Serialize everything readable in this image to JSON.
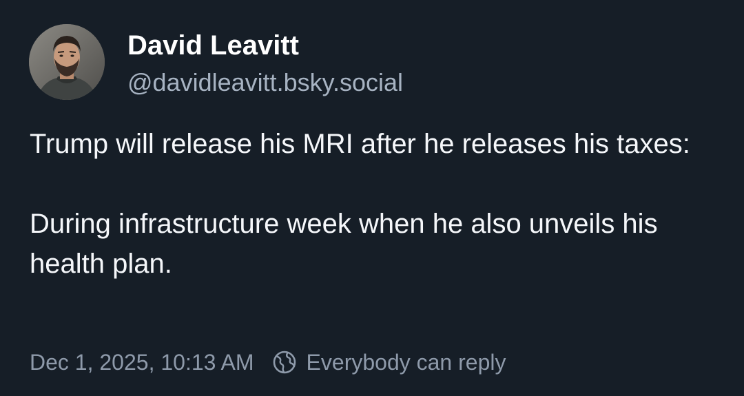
{
  "post": {
    "author": {
      "display_name": "David Leavitt",
      "handle": "@davidleavitt.bsky.social",
      "avatar_icon": "user-avatar-photo"
    },
    "text_paragraphs": [
      "Trump will release his MRI after he releases his taxes:",
      "During infrastructure week when he also unveils his health plan."
    ],
    "timestamp": "Dec 1, 2025, 10:13 AM",
    "reply_setting": {
      "icon": "earth-icon",
      "label": "Everybody can reply"
    }
  },
  "colors": {
    "background": "#161e27",
    "primary_text": "#ffffff",
    "secondary_text": "#a7b3c2",
    "meta_text": "#8e9aaa"
  }
}
